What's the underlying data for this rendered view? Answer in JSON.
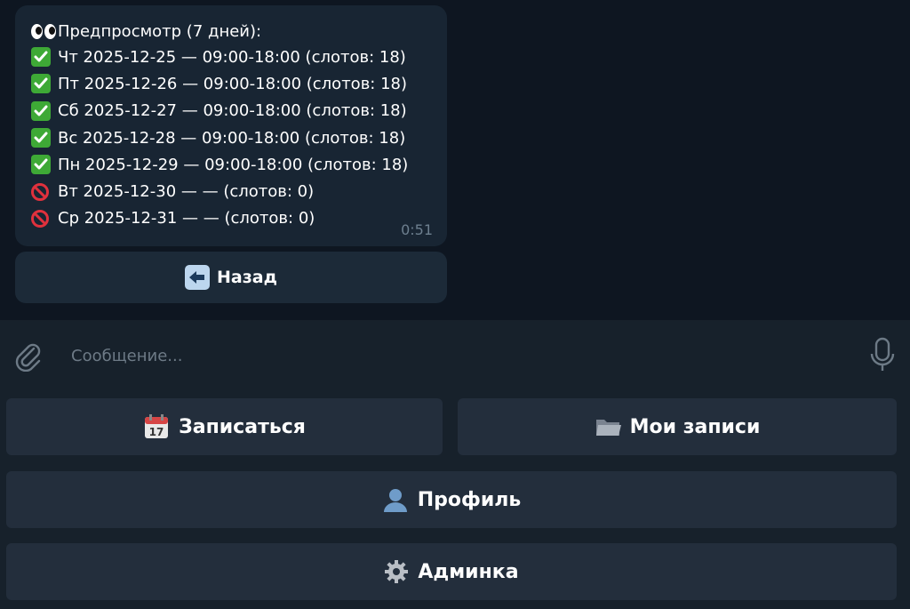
{
  "message": {
    "header": "Предпросмотр (7 дней):",
    "header_icon": "eyes-icon",
    "lines": [
      {
        "icon": "check-mark-icon",
        "text": "Чт 2025-12-25 — 09:00-18:00 (слотов: 18)"
      },
      {
        "icon": "check-mark-icon",
        "text": "Пт 2025-12-26 — 09:00-18:00 (слотов: 18)"
      },
      {
        "icon": "check-mark-icon",
        "text": "Сб 2025-12-27 — 09:00-18:00 (слотов: 18)"
      },
      {
        "icon": "check-mark-icon",
        "text": "Вс 2025-12-28 — 09:00-18:00 (слотов: 18)"
      },
      {
        "icon": "check-mark-icon",
        "text": "Пн 2025-12-29 — 09:00-18:00 (слотов: 18)"
      },
      {
        "icon": "prohibited-icon",
        "text": "Вт 2025-12-30 — — (слотов: 0)"
      },
      {
        "icon": "prohibited-icon",
        "text": "Ср 2025-12-31 — — (слотов: 0)"
      }
    ],
    "time": "0:51"
  },
  "inline_button": {
    "label": "Назад",
    "icon": "back-arrow-icon"
  },
  "composer": {
    "placeholder": "Сообщение..."
  },
  "keyboard": {
    "book": {
      "label": "Записаться",
      "icon": "calendar-icon"
    },
    "my_bookings": {
      "label": "Мои записи",
      "icon": "folder-icon"
    },
    "profile": {
      "label": "Профиль",
      "icon": "user-icon"
    },
    "admin": {
      "label": "Админка",
      "icon": "gear-icon"
    }
  },
  "colors": {
    "background": "#0e1621",
    "bubble": "#182533",
    "panel": "#17212b",
    "button": "#232e3c",
    "check": "#3ea936",
    "prohibited": "#e0313d"
  }
}
